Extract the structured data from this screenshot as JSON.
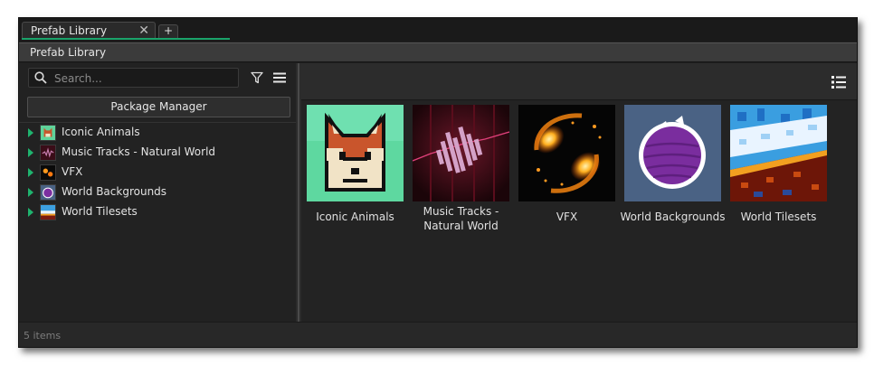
{
  "tabs": [
    {
      "label": "Prefab Library",
      "close": "✕"
    }
  ],
  "tab_add_label": "+",
  "window_title": "Prefab Library",
  "search": {
    "placeholder": "Search...",
    "value": ""
  },
  "package_manager_label": "Package Manager",
  "accent_color": "#1aa36a",
  "tree": [
    {
      "label": "Iconic Animals",
      "icon": "fox-icon"
    },
    {
      "label": "Music Tracks - Natural World",
      "icon": "waveform-icon"
    },
    {
      "label": "VFX",
      "icon": "fireball-icon"
    },
    {
      "label": "World Backgrounds",
      "icon": "planet-icon"
    },
    {
      "label": "World Tilesets",
      "icon": "tileset-icon"
    }
  ],
  "grid": [
    {
      "caption": "Iconic Animals"
    },
    {
      "caption": "Music Tracks - Natural World"
    },
    {
      "caption": "VFX"
    },
    {
      "caption": "World Backgrounds"
    },
    {
      "caption": "World Tilesets"
    }
  ],
  "status": "5 items"
}
